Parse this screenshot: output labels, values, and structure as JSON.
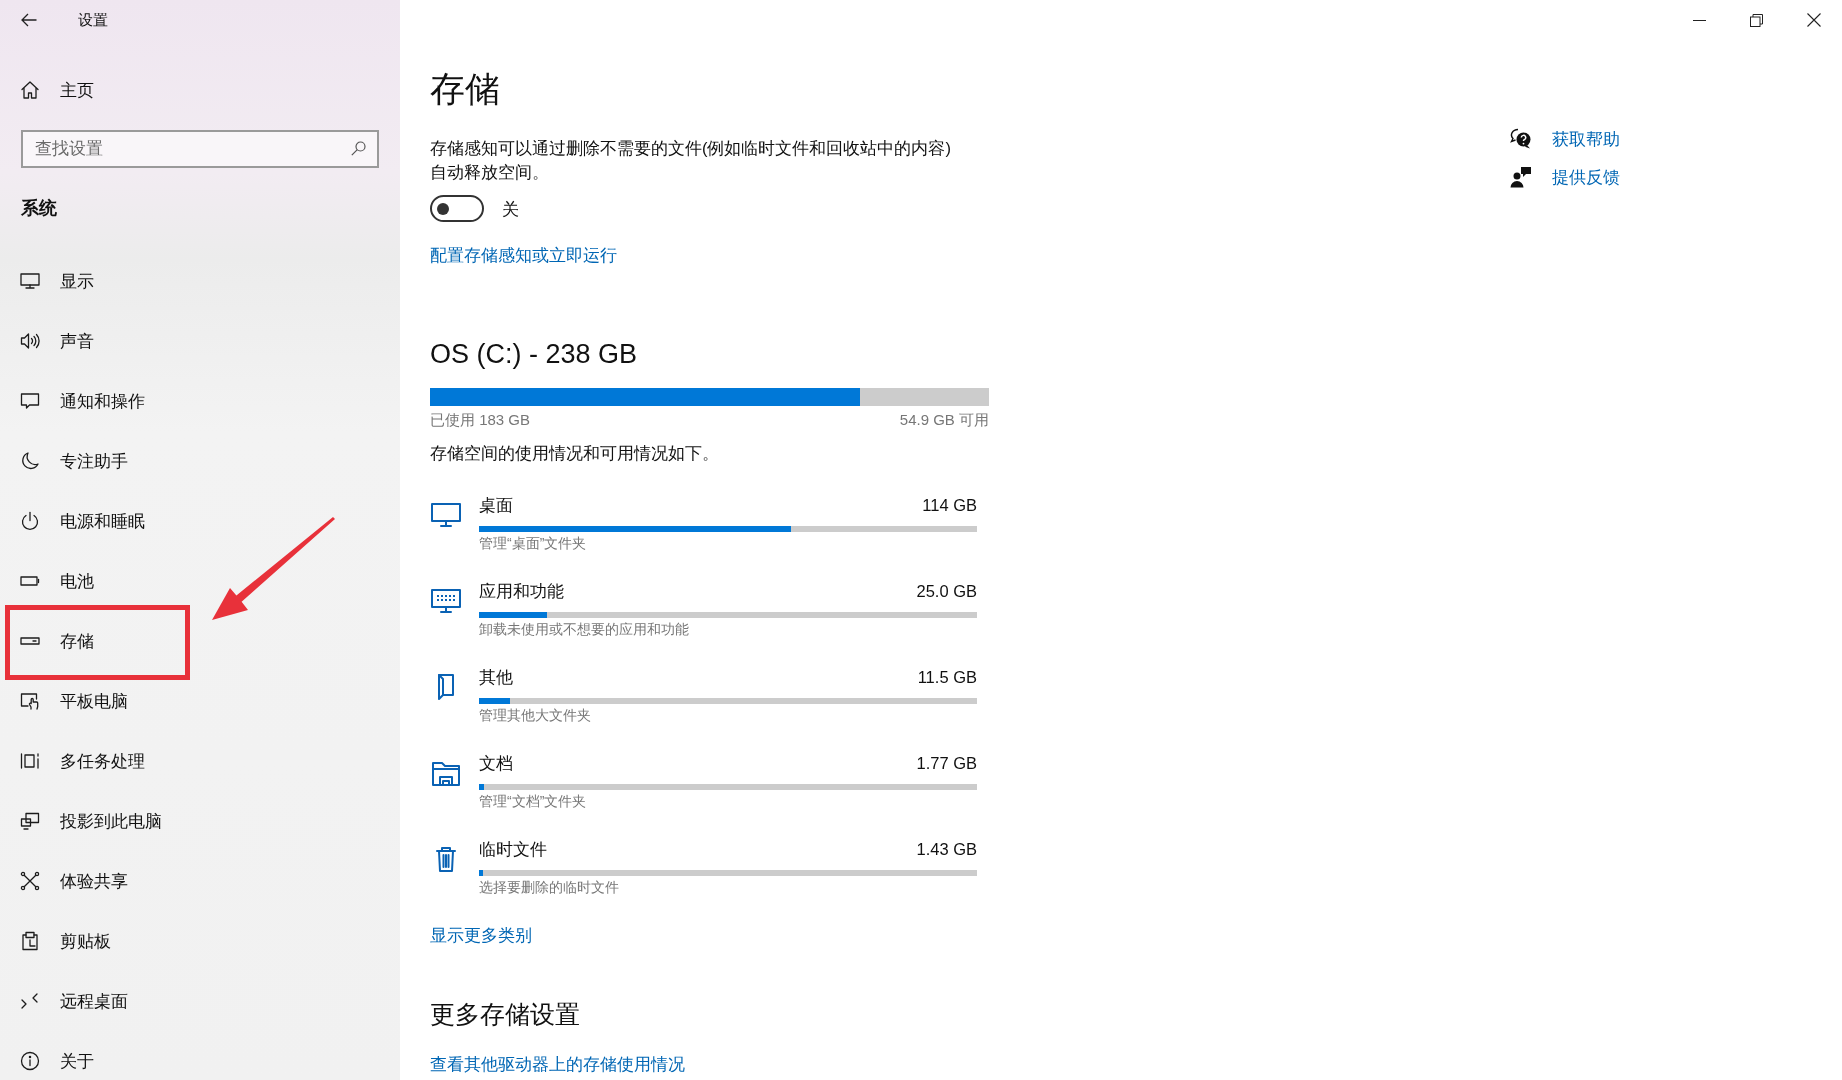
{
  "window": {
    "title": "设置"
  },
  "sidebar": {
    "home": "主页",
    "search": {
      "placeholder": "查找设置"
    },
    "section": "系统",
    "items": [
      {
        "label": "显示",
        "highlighted": false
      },
      {
        "label": "声音",
        "highlighted": false
      },
      {
        "label": "通知和操作",
        "highlighted": false
      },
      {
        "label": "专注助手",
        "highlighted": false
      },
      {
        "label": "电源和睡眠",
        "highlighted": false
      },
      {
        "label": "电池",
        "highlighted": false
      },
      {
        "label": "存储",
        "highlighted": true
      },
      {
        "label": "平板电脑",
        "highlighted": false
      },
      {
        "label": "多任务处理",
        "highlighted": false
      },
      {
        "label": "投影到此电脑",
        "highlighted": false
      },
      {
        "label": "体验共享",
        "highlighted": false
      },
      {
        "label": "剪贴板",
        "highlighted": false
      },
      {
        "label": "远程桌面",
        "highlighted": false
      },
      {
        "label": "关于",
        "highlighted": false
      }
    ]
  },
  "page_title": "存储",
  "storage_sense": {
    "description": "存储感知可以通过删除不需要的文件(例如临时文件和回收站中的内容)自动释放空间。",
    "on": false,
    "state_label": "关",
    "link": "配置存储感知或立即运行"
  },
  "drive": {
    "title": "OS (C:) - 238 GB",
    "level": 0.77,
    "used": "已使用 183 GB",
    "free": "54.9 GB 可用",
    "summary": "存储空间的使用情况和可用情况如下。"
  },
  "categories": [
    {
      "name": "桌面",
      "size": "114 GB",
      "level": 0.627,
      "description": "管理“桌面”文件夹"
    },
    {
      "name": "应用和功能",
      "size": "25.0 GB",
      "level": 0.137,
      "description": "卸载未使用或不想要的应用和功能"
    },
    {
      "name": "其他",
      "size": "11.5 GB",
      "level": 0.063,
      "description": "管理其他大文件夹"
    },
    {
      "name": "文档",
      "size": "1.77 GB",
      "level": 0.01,
      "description": "管理“文档”文件夹"
    },
    {
      "name": "临时文件",
      "size": "1.43 GB",
      "level": 0.008,
      "description": "选择要删除的临时文件"
    }
  ],
  "show_more_link": "显示更多类别",
  "more_settings": {
    "title": "更多存储设置",
    "link": "查看其他驱动器上的存储使用情况"
  },
  "help_links": [
    "获取帮助",
    "提供反馈"
  ]
}
